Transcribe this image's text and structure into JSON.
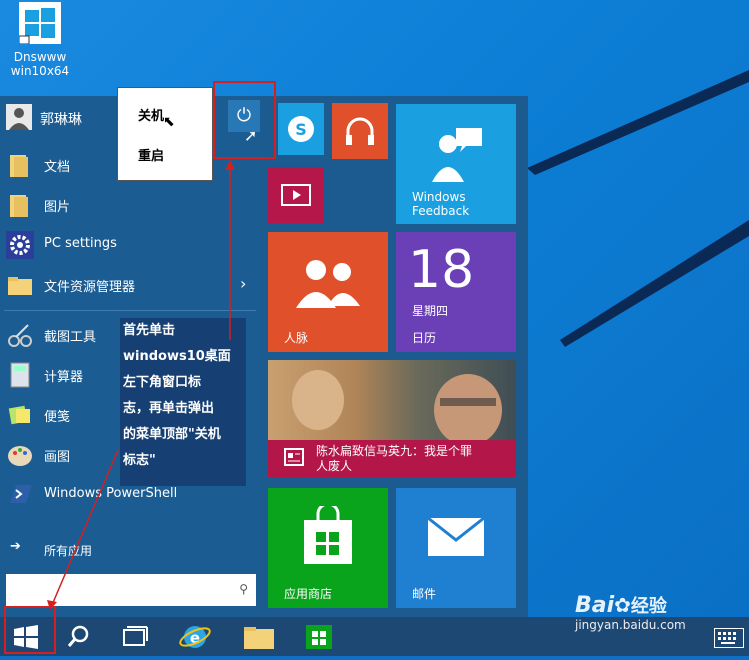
{
  "desktop": {
    "icon_label_line1": "Dnswww",
    "icon_label_line2": "win10x64"
  },
  "start_menu": {
    "user_name": "郭琳琳",
    "items": [
      {
        "label": "文档"
      },
      {
        "label": "图片"
      },
      {
        "label": "PC settings"
      },
      {
        "label": "文件资源管理器"
      },
      {
        "label": "截图工具"
      },
      {
        "label": "计算器"
      },
      {
        "label": "便笺"
      },
      {
        "label": "画图"
      },
      {
        "label": "Windows PowerShell"
      }
    ],
    "all_apps": "所有应用"
  },
  "power_menu": {
    "shutdown": "关机",
    "restart": "重启"
  },
  "annotation": {
    "lines": [
      "首先单击",
      "windows10桌面",
      "左下角窗口标",
      "志，再单击弹出",
      "的菜单顶部\"关机",
      "标志\""
    ]
  },
  "tiles": {
    "feedback": {
      "line1": "Windows",
      "line2": "Feedback"
    },
    "people": {
      "label": "人脉"
    },
    "calendar": {
      "day": "18",
      "weekday": "星期四",
      "label": "日历"
    },
    "news": {
      "headline_line1": "陈水扁致信马英九：我是个罪",
      "headline_line2": "人废人"
    },
    "store": {
      "label": "应用商店"
    },
    "mail": {
      "label": "邮件"
    }
  },
  "watermark": {
    "brand": "Bai",
    "brand2": "经验",
    "url": "jingyan.baidu.com"
  },
  "colors": {
    "accent": "#1b5c92",
    "skype": "#1aa0e0",
    "music": "#e0502a",
    "video": "#b5174a",
    "feedback": "#1aa0e0",
    "people": "#e0502a",
    "calendar": "#6b3fb6",
    "news": "#b3174a",
    "store": "#0aa31c",
    "mail": "#1f7fd0",
    "redbox": "#d42020"
  }
}
